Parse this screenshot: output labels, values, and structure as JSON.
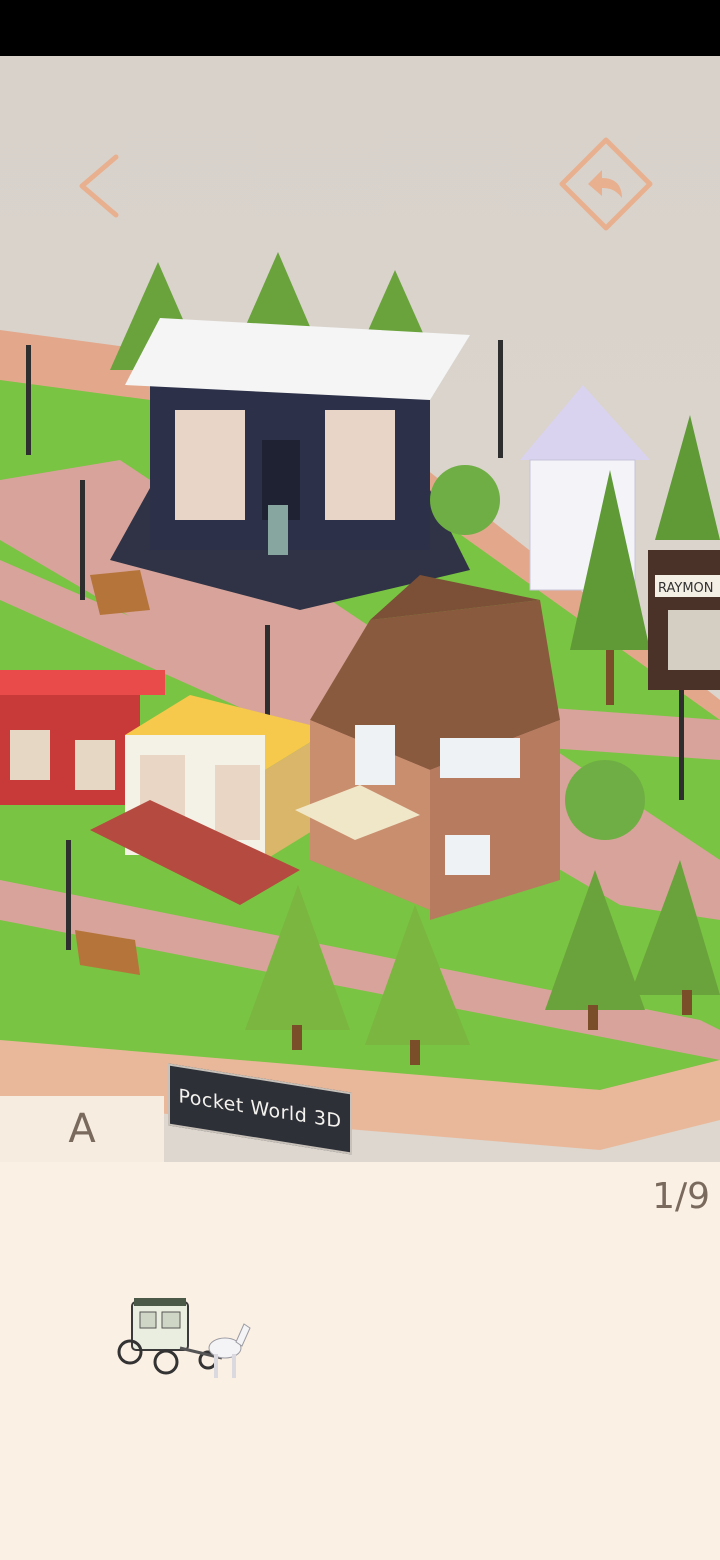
{
  "header": {
    "back_icon": "chevron-left-icon",
    "undo_icon": "undo-diamond-icon"
  },
  "scene": {
    "sign_text": "Pocket World 3D",
    "store_sign_text": "RAYMON"
  },
  "tabs": [
    {
      "label": "A"
    }
  ],
  "panel": {
    "counter": "1/9",
    "items": [
      {
        "icon": "horse-carriage-icon"
      }
    ]
  },
  "colors": {
    "accent": "#e8b08f",
    "panel_bg": "#fbf0e4",
    "grass": "#7ac943",
    "road": "#e0a589",
    "brick_path": "#d9a39a"
  }
}
